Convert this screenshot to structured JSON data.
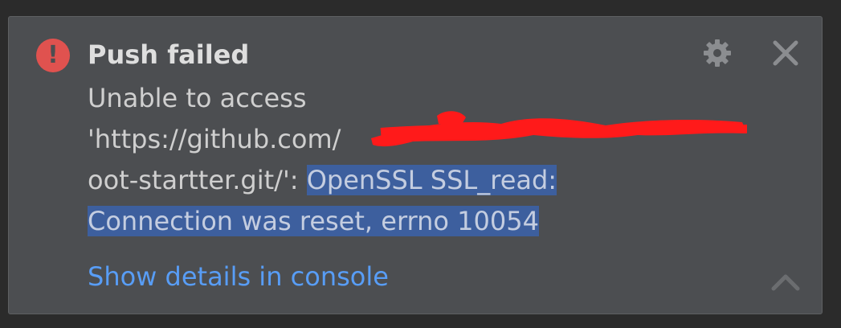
{
  "notification": {
    "icon": "error-icon",
    "icon_glyph": "!",
    "title": "Push failed",
    "message_lines": [
      "Unable to access",
      "'https://github.com/",
      "oot-startter.git/': ",
      "OpenSSL SSL_read:",
      "Connection was reset, errno 10054"
    ],
    "link_label": "Show details in console",
    "colors": {
      "background": "#4c4e51",
      "error": "#e0524f",
      "link": "#589df6",
      "selection": "#3d5f9e",
      "redaction": "#ff1a1a"
    }
  }
}
